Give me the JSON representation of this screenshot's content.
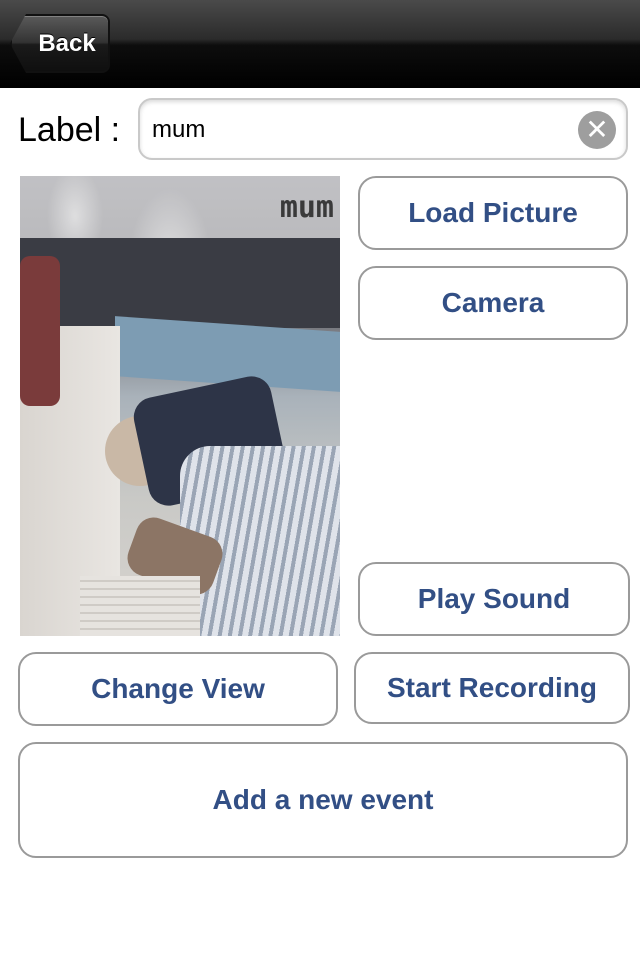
{
  "navbar": {
    "back_label": "Back"
  },
  "label_row": {
    "label": "Label :",
    "value": "mum"
  },
  "picture": {
    "caption": "mum"
  },
  "buttons": {
    "load_picture": "Load Picture",
    "camera": "Camera",
    "play_sound": "Play Sound",
    "change_view": "Change View",
    "start_recording": "Start Recording",
    "add_event": "Add a new event"
  },
  "colors": {
    "button_text": "#324f85",
    "button_border": "#9a9a9a",
    "navbar": "#1a1a1a"
  }
}
